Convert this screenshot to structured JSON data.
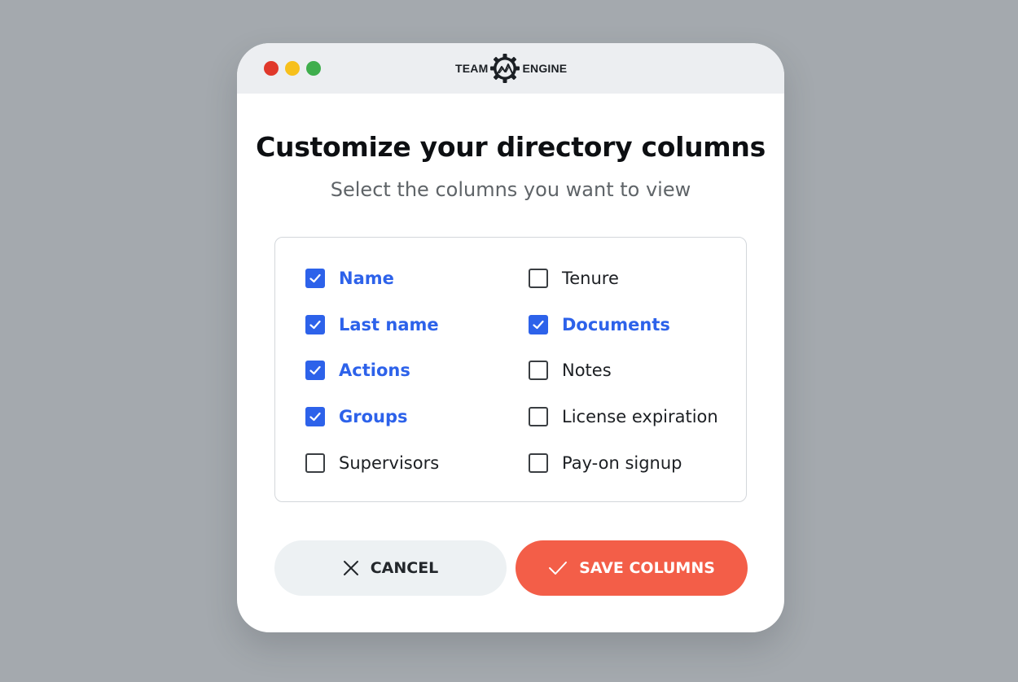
{
  "colors": {
    "background": "#a4a9ae",
    "window": "#ffffff",
    "titlebar": "#eceef1",
    "accent_blue": "#2d62ea",
    "save_button": "#f35e48",
    "cancel_button": "#edf1f3",
    "traffic_red": "#e0382b",
    "traffic_yellow": "#f7c01c",
    "traffic_green": "#3fae4d"
  },
  "brand": {
    "left": "TEAM",
    "right": "ENGINE",
    "icon": "gear-mountain-logo"
  },
  "dialog": {
    "title": "Customize your directory columns",
    "subtitle": "Select the columns you want to view"
  },
  "columns": {
    "left": [
      {
        "label": "Name",
        "checked": true
      },
      {
        "label": "Last name",
        "checked": true
      },
      {
        "label": "Actions",
        "checked": true
      },
      {
        "label": "Groups",
        "checked": true
      },
      {
        "label": "Supervisors",
        "checked": false
      }
    ],
    "right": [
      {
        "label": "Tenure",
        "checked": false
      },
      {
        "label": "Documents",
        "checked": true
      },
      {
        "label": "Notes",
        "checked": false
      },
      {
        "label": "License expiration",
        "checked": false
      },
      {
        "label": "Pay-on signup",
        "checked": false
      }
    ]
  },
  "buttons": {
    "cancel_label": "CANCEL",
    "cancel_icon": "close-icon",
    "save_label": "SAVE COLUMNS",
    "save_icon": "checkmark-icon"
  }
}
